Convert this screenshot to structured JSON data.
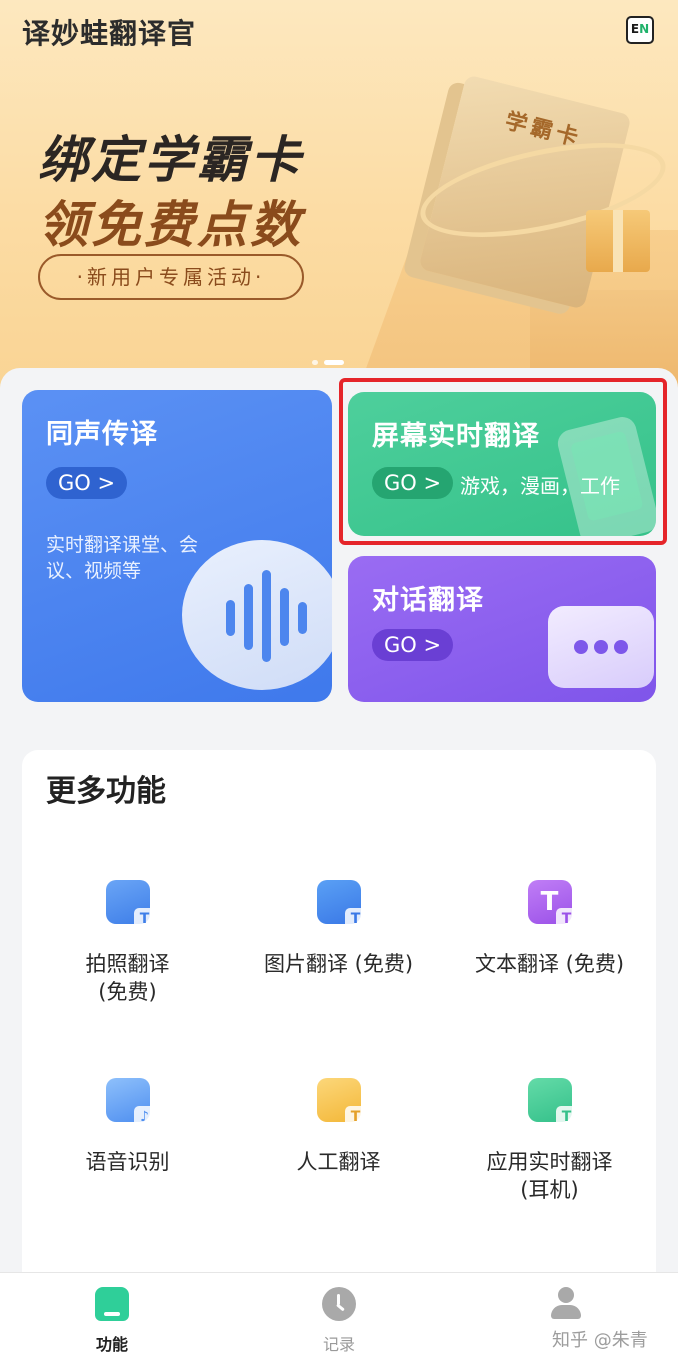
{
  "header": {
    "app_title": "译妙蛙翻译官",
    "lang_toggle_prefix": "E",
    "lang_toggle_suffix": "N"
  },
  "banner": {
    "line1": "绑定学霸卡",
    "line2": "领免费点数",
    "pill": "·新用户专属活动·",
    "card_label": "学霸卡",
    "carousel_active_index": 2,
    "carousel_count": 2
  },
  "cards": {
    "simultaneous": {
      "title": "同声传译",
      "go": "GO >",
      "description": "实时翻译课堂、会议、视频等"
    },
    "screen": {
      "title": "屏幕实时翻译",
      "go": "GO >",
      "subtitle": "游戏，漫画，工作"
    },
    "dialog": {
      "title": "对话翻译",
      "go": "GO >"
    }
  },
  "more": {
    "title": "更多功能",
    "items": [
      {
        "label": "拍照翻译\n(免费)",
        "icon": "camera-translate-icon"
      },
      {
        "label": "图片翻译 (免费)",
        "icon": "image-translate-icon"
      },
      {
        "label": "文本翻译 (免费)",
        "icon": "text-translate-icon"
      },
      {
        "label": "语音识别",
        "icon": "voice-recognition-icon"
      },
      {
        "label": "人工翻译",
        "icon": "human-translate-icon"
      },
      {
        "label": "应用实时翻译\n(耳机)",
        "icon": "headphone-translate-icon"
      }
    ]
  },
  "nav": {
    "items": [
      {
        "label": "功能",
        "icon": "home-icon",
        "active": true
      },
      {
        "label": "记录",
        "icon": "clock-icon",
        "active": false
      },
      {
        "label": "",
        "icon": "user-icon",
        "active": false
      }
    ]
  },
  "watermark": "知乎 @朱青",
  "colors": {
    "simultaneous_card": "#4a83ef",
    "screen_card": "#3fc891",
    "dialog_card": "#8a5ff0",
    "highlight_box": "#e5252a",
    "active_nav": "#2fcf99"
  }
}
